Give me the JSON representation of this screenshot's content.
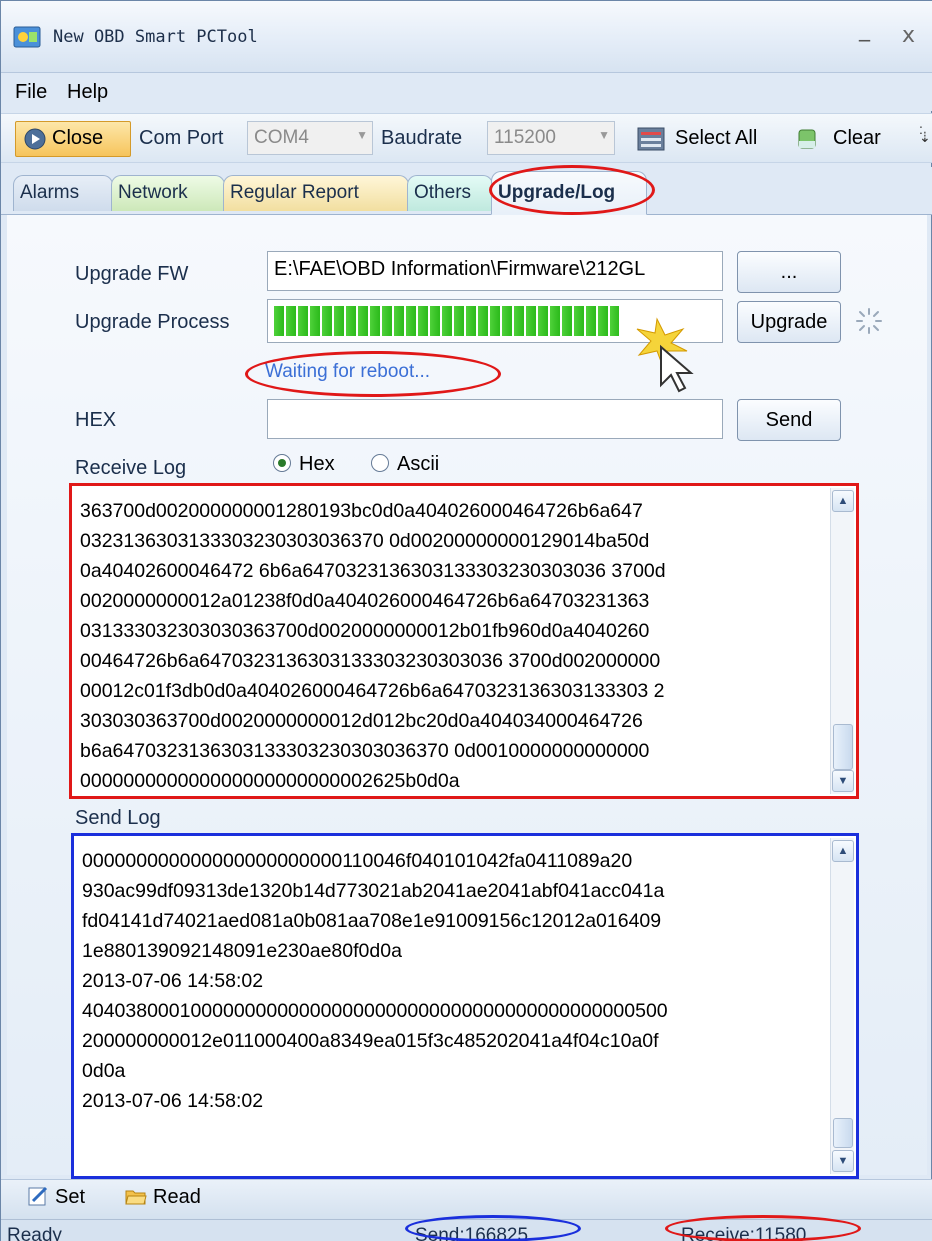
{
  "window": {
    "title": "New OBD Smart PCTool"
  },
  "menu": {
    "file": "File",
    "help": "Help"
  },
  "toolbar": {
    "close_label": "Close",
    "com_port_label": "Com Port",
    "com_port_value": "COM4",
    "baudrate_label": "Baudrate",
    "baudrate_value": "115200",
    "select_all_label": "Select All",
    "clear_label": "Clear"
  },
  "tabs": [
    "Alarms",
    "Network",
    "Regular Report",
    "Others",
    "Upgrade/Log"
  ],
  "active_tab": "Upgrade/Log",
  "upgrade": {
    "fw_label": "Upgrade FW",
    "fw_path": "E:\\FAE\\OBD Information\\Firmware\\212GL",
    "browse_label": "...",
    "process_label": "Upgrade Process",
    "progress_fraction": 0.78,
    "upgrade_button": "Upgrade",
    "status_text": "Waiting for reboot..."
  },
  "hex": {
    "label": "HEX",
    "value": "",
    "send_button": "Send"
  },
  "receive_log": {
    "label": "Receive Log",
    "mode_hex": "Hex",
    "mode_ascii": "Ascii",
    "selected_mode": "Hex",
    "lines": [
      "363700d002000000001280193bc0d0a404026000464726b6a647",
      "0323136303133303230303036370 0d00200000000129014ba50d",
      "0a40402600046472 6b6a6470323136303133303230303036 3700d",
      "0020000000012a01238f0d0a404026000464726b6a64703231363",
      "031333032303030363700d0020000000012b01fb960d0a4040260",
      "00464726b6a6470323136303133303230303036 3700d002000000",
      "00012c01f3db0d0a404026000464726b6a6470323136303133303 2",
      "303030363700d0020000000012d012bc20d0a404034000464726",
      "b6a6470323136303133303230303036370 0d0010000000000000",
      "000000000000000000000000002625b0d0a"
    ]
  },
  "send_log": {
    "label": "Send Log",
    "lines": [
      "000000000000000000000000110046f040101042fa0411089a20",
      "930ac99df09313de1320b14d773021ab2041ae2041abf041acc041a",
      "fd04141d74021aed081a0b081aa708e1e91009156c12012a016409",
      "1e880139092148091e230ae80f0d0a",
      "2013-07-06 14:58:02",
      "404038000100000000000000000000000000000000000000000500",
      "200000000012e011000400a8349ea015f3c485202041a4f04c10a0f",
      "0d0a",
      "2013-07-06 14:58:02"
    ]
  },
  "bottom": {
    "set_label": "Set",
    "read_label": "Read"
  },
  "status": {
    "ready": "Ready",
    "send": "Send:166825",
    "receive": "Receive:11580"
  },
  "colors": {
    "highlight_red": "#e01818",
    "highlight_blue": "#1a2fdc",
    "progress_green": "#2ebc1d"
  }
}
